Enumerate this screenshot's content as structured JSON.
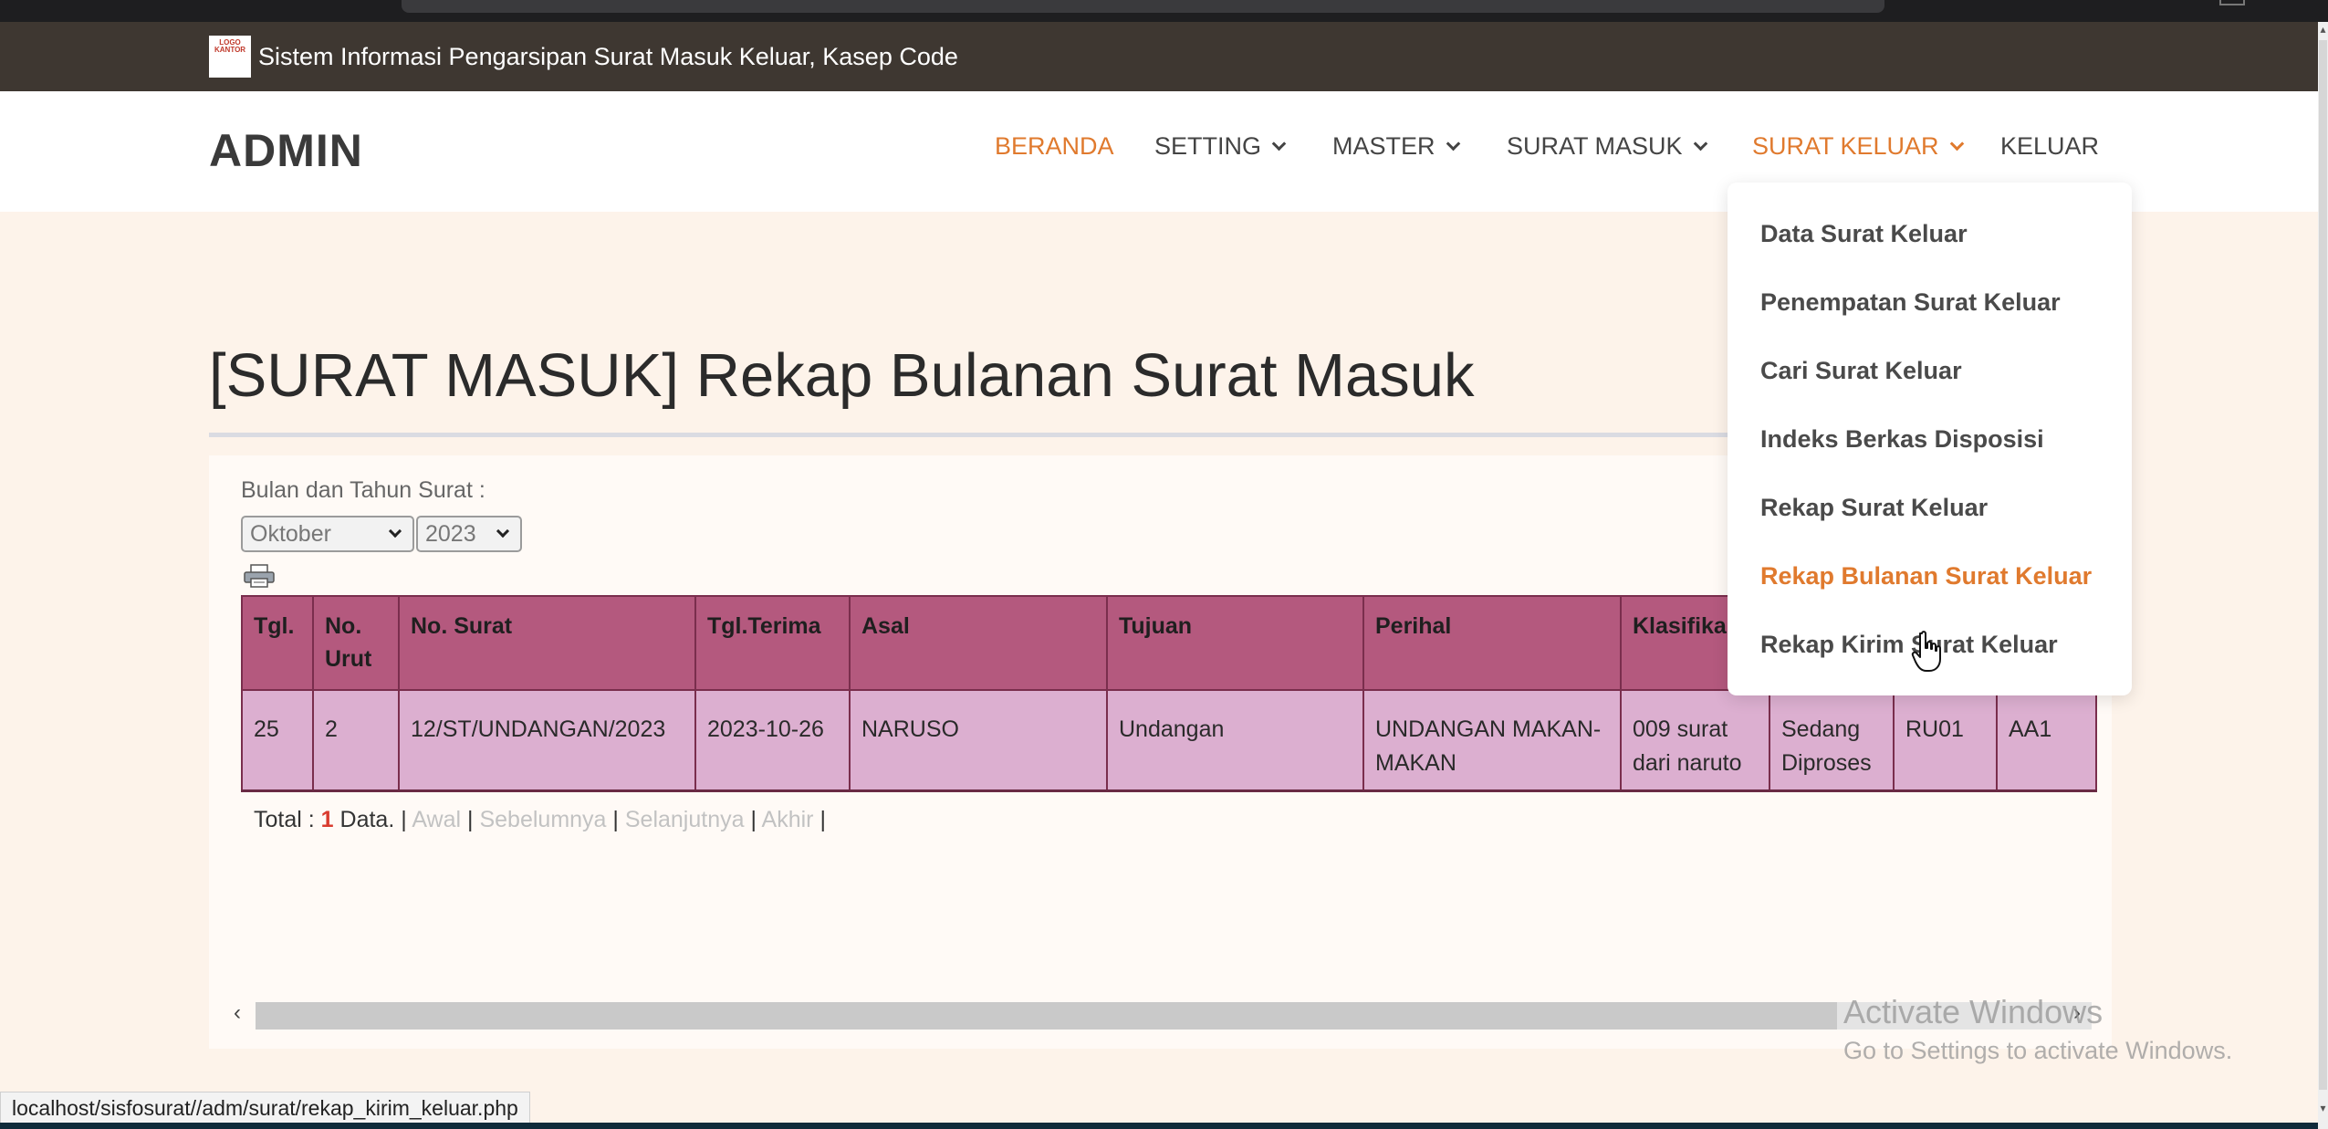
{
  "topbar": {
    "logo_text": "LOGO KANTOR",
    "title": "Sistem Informasi Pengarsipan Surat Masuk Keluar, Kasep Code"
  },
  "navbar": {
    "brand": "ADMIN",
    "items": [
      {
        "label": "BERANDA"
      },
      {
        "label": "SETTING"
      },
      {
        "label": "MASTER"
      },
      {
        "label": "SURAT MASUK"
      },
      {
        "label": "SURAT KELUAR"
      },
      {
        "label": "KELUAR"
      }
    ]
  },
  "dropdown": {
    "items": [
      {
        "label": "Data Surat Keluar"
      },
      {
        "label": "Penempatan Surat Keluar"
      },
      {
        "label": "Cari Surat Keluar"
      },
      {
        "label": "Indeks Berkas Disposisi"
      },
      {
        "label": "Rekap Surat Keluar"
      },
      {
        "label": "Rekap Bulanan Surat Keluar"
      },
      {
        "label": "Rekap Kirim Surat Keluar"
      }
    ]
  },
  "page": {
    "title": "[SURAT MASUK] Rekap Bulanan Surat Masuk"
  },
  "filter": {
    "label": "Bulan dan Tahun Surat :",
    "month": "Oktober",
    "year": "2023"
  },
  "table": {
    "headers": [
      "Tgl.",
      "No. Urut",
      "No. Surat",
      "Tgl.Terima",
      "Asal",
      "Tujuan",
      "Perihal",
      "Klasifika",
      "",
      "",
      ""
    ],
    "rows": [
      [
        "25",
        "2",
        "12/ST/UNDANGAN/2023",
        "2023-10-26",
        "NARUSO",
        "Undangan",
        "UNDANGAN MAKAN-MAKAN",
        "009 surat dari naruto",
        "Sedang Diproses",
        "RU01",
        "AA1"
      ]
    ]
  },
  "footer": {
    "total_prefix": "Total :",
    "total_count": "1",
    "total_suffix": "Data.",
    "first": "Awal",
    "prev": "Sebelumnya",
    "next": "Selanjutnya",
    "last": "Akhir",
    "separator": "|"
  },
  "watermark": {
    "line1": "Activate Windows",
    "line2": "Go to Settings to activate Windows."
  },
  "status_bar": {
    "url": "localhost/sisfosurat//adm/surat/rekap_kirim_keluar.php"
  },
  "colors": {
    "accent": "#e07a2e",
    "topbar": "#3e3731",
    "table_header": "#b4597e",
    "table_row": "#dcafd0",
    "page_bg": "#fdf3ea"
  }
}
